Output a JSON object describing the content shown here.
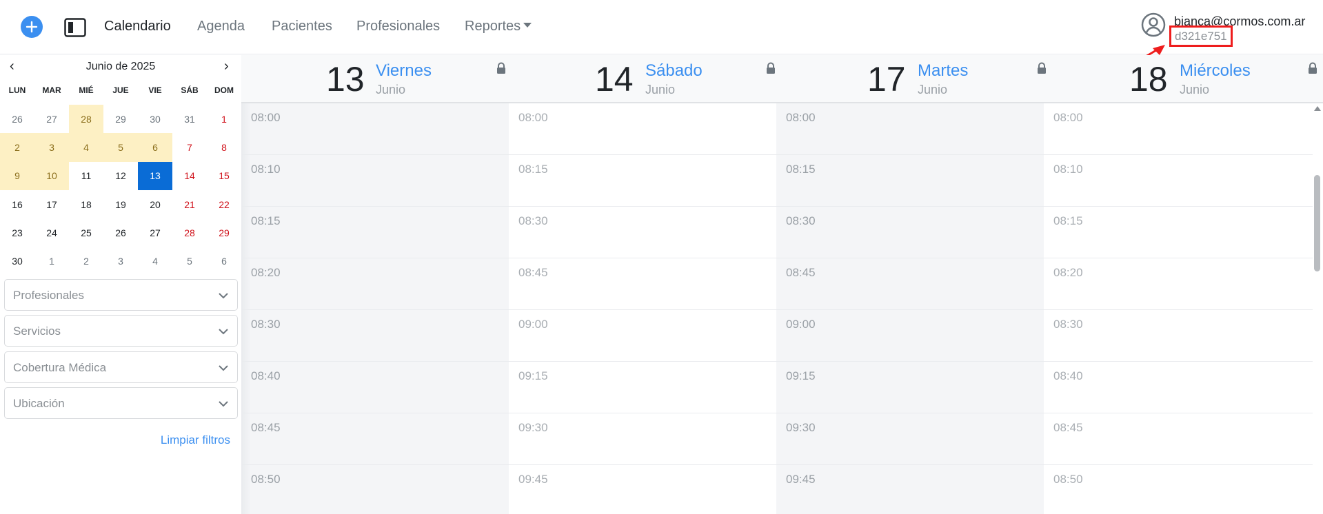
{
  "navbar": {
    "links": [
      {
        "label": "Calendario",
        "active": true
      },
      {
        "label": "Agenda",
        "active": false
      },
      {
        "label": "Pacientes",
        "active": false
      },
      {
        "label": "Profesionales",
        "active": false
      },
      {
        "label": "Reportes",
        "active": false,
        "dropdown": true
      }
    ],
    "user": {
      "email": "bianca@cormos.com.ar",
      "code": "d321e751",
      "icon": "user-circle-icon"
    },
    "add_icon": "plus-icon",
    "toggle_icon": "sidebar-toggle-icon"
  },
  "mini_calendar": {
    "month_label": "Junio de 2025",
    "prev": "‹",
    "next": "›",
    "weekdays": [
      "LUN",
      "MAR",
      "MIÉ",
      "JUE",
      "VIE",
      "SÁB",
      "DOM"
    ],
    "weeks": [
      [
        "26",
        "27",
        "28",
        "29",
        "30",
        "31",
        "1"
      ],
      [
        "2",
        "3",
        "4",
        "5",
        "6",
        "7",
        "8"
      ],
      [
        "9",
        "10",
        "11",
        "12",
        "13",
        "14",
        "15"
      ],
      [
        "16",
        "17",
        "18",
        "19",
        "20",
        "21",
        "22"
      ],
      [
        "23",
        "24",
        "25",
        "26",
        "27",
        "28",
        "29"
      ],
      [
        "30",
        "1",
        "2",
        "3",
        "4",
        "5",
        "6"
      ]
    ],
    "selected": "13"
  },
  "filters": [
    {
      "label": "Profesionales"
    },
    {
      "label": "Servicios"
    },
    {
      "label": "Cobertura Médica"
    },
    {
      "label": "Ubicación"
    }
  ],
  "clear_filters": "Limpiar filtros",
  "columns": [
    {
      "day_number": "13",
      "day_name": "Viernes",
      "month": "Junio",
      "locked": true,
      "times": [
        "08:00",
        "08:10",
        "08:15",
        "08:20",
        "08:30",
        "08:40",
        "08:45",
        "08:50"
      ]
    },
    {
      "day_number": "14",
      "day_name": "Sábado",
      "month": "Junio",
      "locked": true,
      "times": [
        "08:00",
        "08:15",
        "08:30",
        "08:45",
        "09:00",
        "09:15",
        "09:30",
        "09:45"
      ]
    },
    {
      "day_number": "17",
      "day_name": "Martes",
      "month": "Junio",
      "locked": true,
      "times": [
        "08:00",
        "08:15",
        "08:30",
        "08:45",
        "09:00",
        "09:15",
        "09:30",
        "09:45"
      ]
    },
    {
      "day_number": "18",
      "day_name": "Miércoles",
      "month": "Junio",
      "locked": true,
      "times": [
        "08:00",
        "08:10",
        "08:15",
        "08:20",
        "08:30",
        "08:40",
        "08:45",
        "08:50"
      ]
    }
  ],
  "colors": {
    "accent": "#3b8ff0",
    "selected_day": "#0a6cd6",
    "highlight_day": "#fdf0c4",
    "weekend": "#d0121b",
    "annotation": "#ee1d1d"
  }
}
